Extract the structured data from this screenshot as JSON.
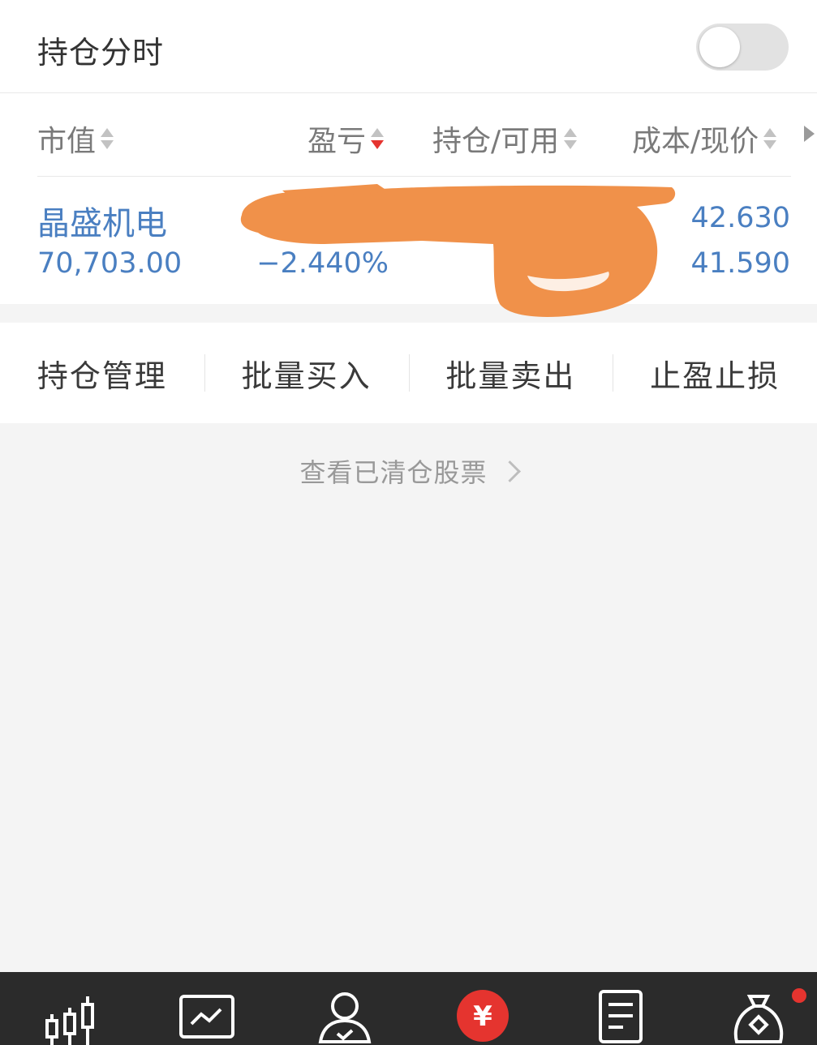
{
  "header": {
    "title": "持仓分时",
    "toggle_on": false
  },
  "table": {
    "columns": {
      "market_value": "市值",
      "profit_loss": "盈亏",
      "position_available": "持仓/可用",
      "cost_current": "成本/现价"
    },
    "rows": [
      {
        "name": "晶盛机电",
        "market_value": "70,703.00",
        "profit_loss_pct": "−2.440%",
        "cost": "42.630",
        "current": "41.590"
      }
    ]
  },
  "actions": {
    "manage": "持仓管理",
    "batch_buy": "批量买入",
    "batch_sell": "批量卖出",
    "stop": "止盈止损"
  },
  "cleared_link": "查看已清仓股票",
  "bottom_nav": {
    "items": [
      "candlestick-icon",
      "trend-chart-icon",
      "user-icon",
      "yuan-icon",
      "document-icon",
      "money-bag-icon"
    ],
    "yuan_symbol": "¥",
    "active_color": "#e5342f",
    "has_notification": true
  },
  "colors": {
    "accent_blue": "#4a7fc1",
    "accent_red": "#e5342f",
    "scribble_orange": "#f0914a"
  }
}
